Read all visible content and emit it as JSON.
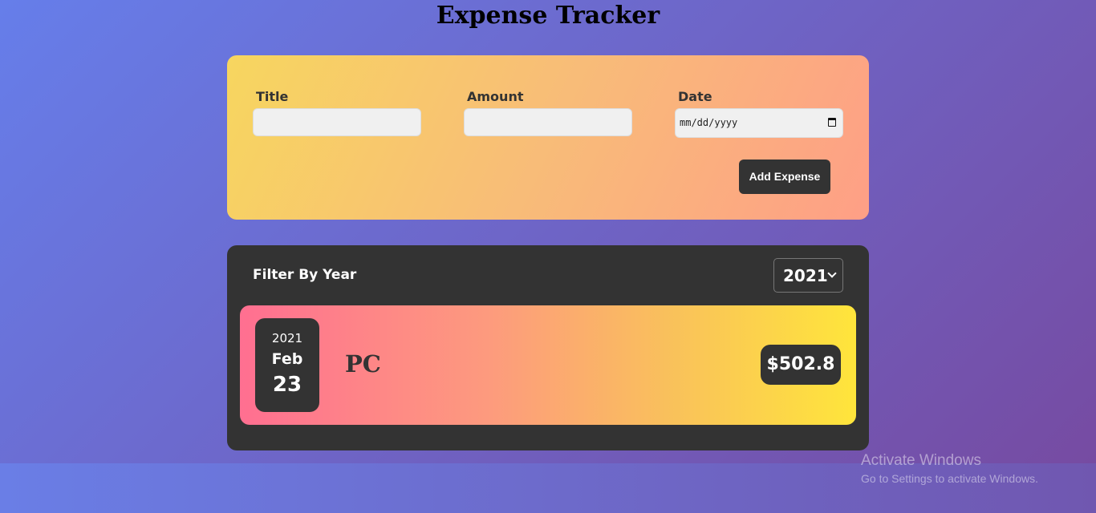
{
  "page": {
    "title": "Expense Tracker"
  },
  "form": {
    "title_label": "Title",
    "title_value": "",
    "amount_label": "Amount",
    "amount_value": "",
    "date_label": "Date",
    "date_placeholder": "mm/dd/yyyy",
    "submit_label": "Add Expense"
  },
  "filter": {
    "label": "Filter By Year",
    "selected_year": "2021"
  },
  "expenses": [
    {
      "year": "2021",
      "month": "Feb",
      "day": "23",
      "title": "PC",
      "amount": "$502.8"
    }
  ],
  "watermark": {
    "line1": "Activate Windows",
    "line2": "Go to Settings to activate Windows."
  },
  "colors": {
    "card_dark": "#333333",
    "form_gradient_start": "#f7d65f",
    "form_gradient_end": "#fe9f86",
    "item_gradient_start": "#ff6f91",
    "item_gradient_end": "#ffe53b",
    "background_start": "#667eea",
    "background_end": "#764ba2"
  },
  "icons": {
    "date_picker": "calendar-icon",
    "select": "chevron-down-icon"
  }
}
